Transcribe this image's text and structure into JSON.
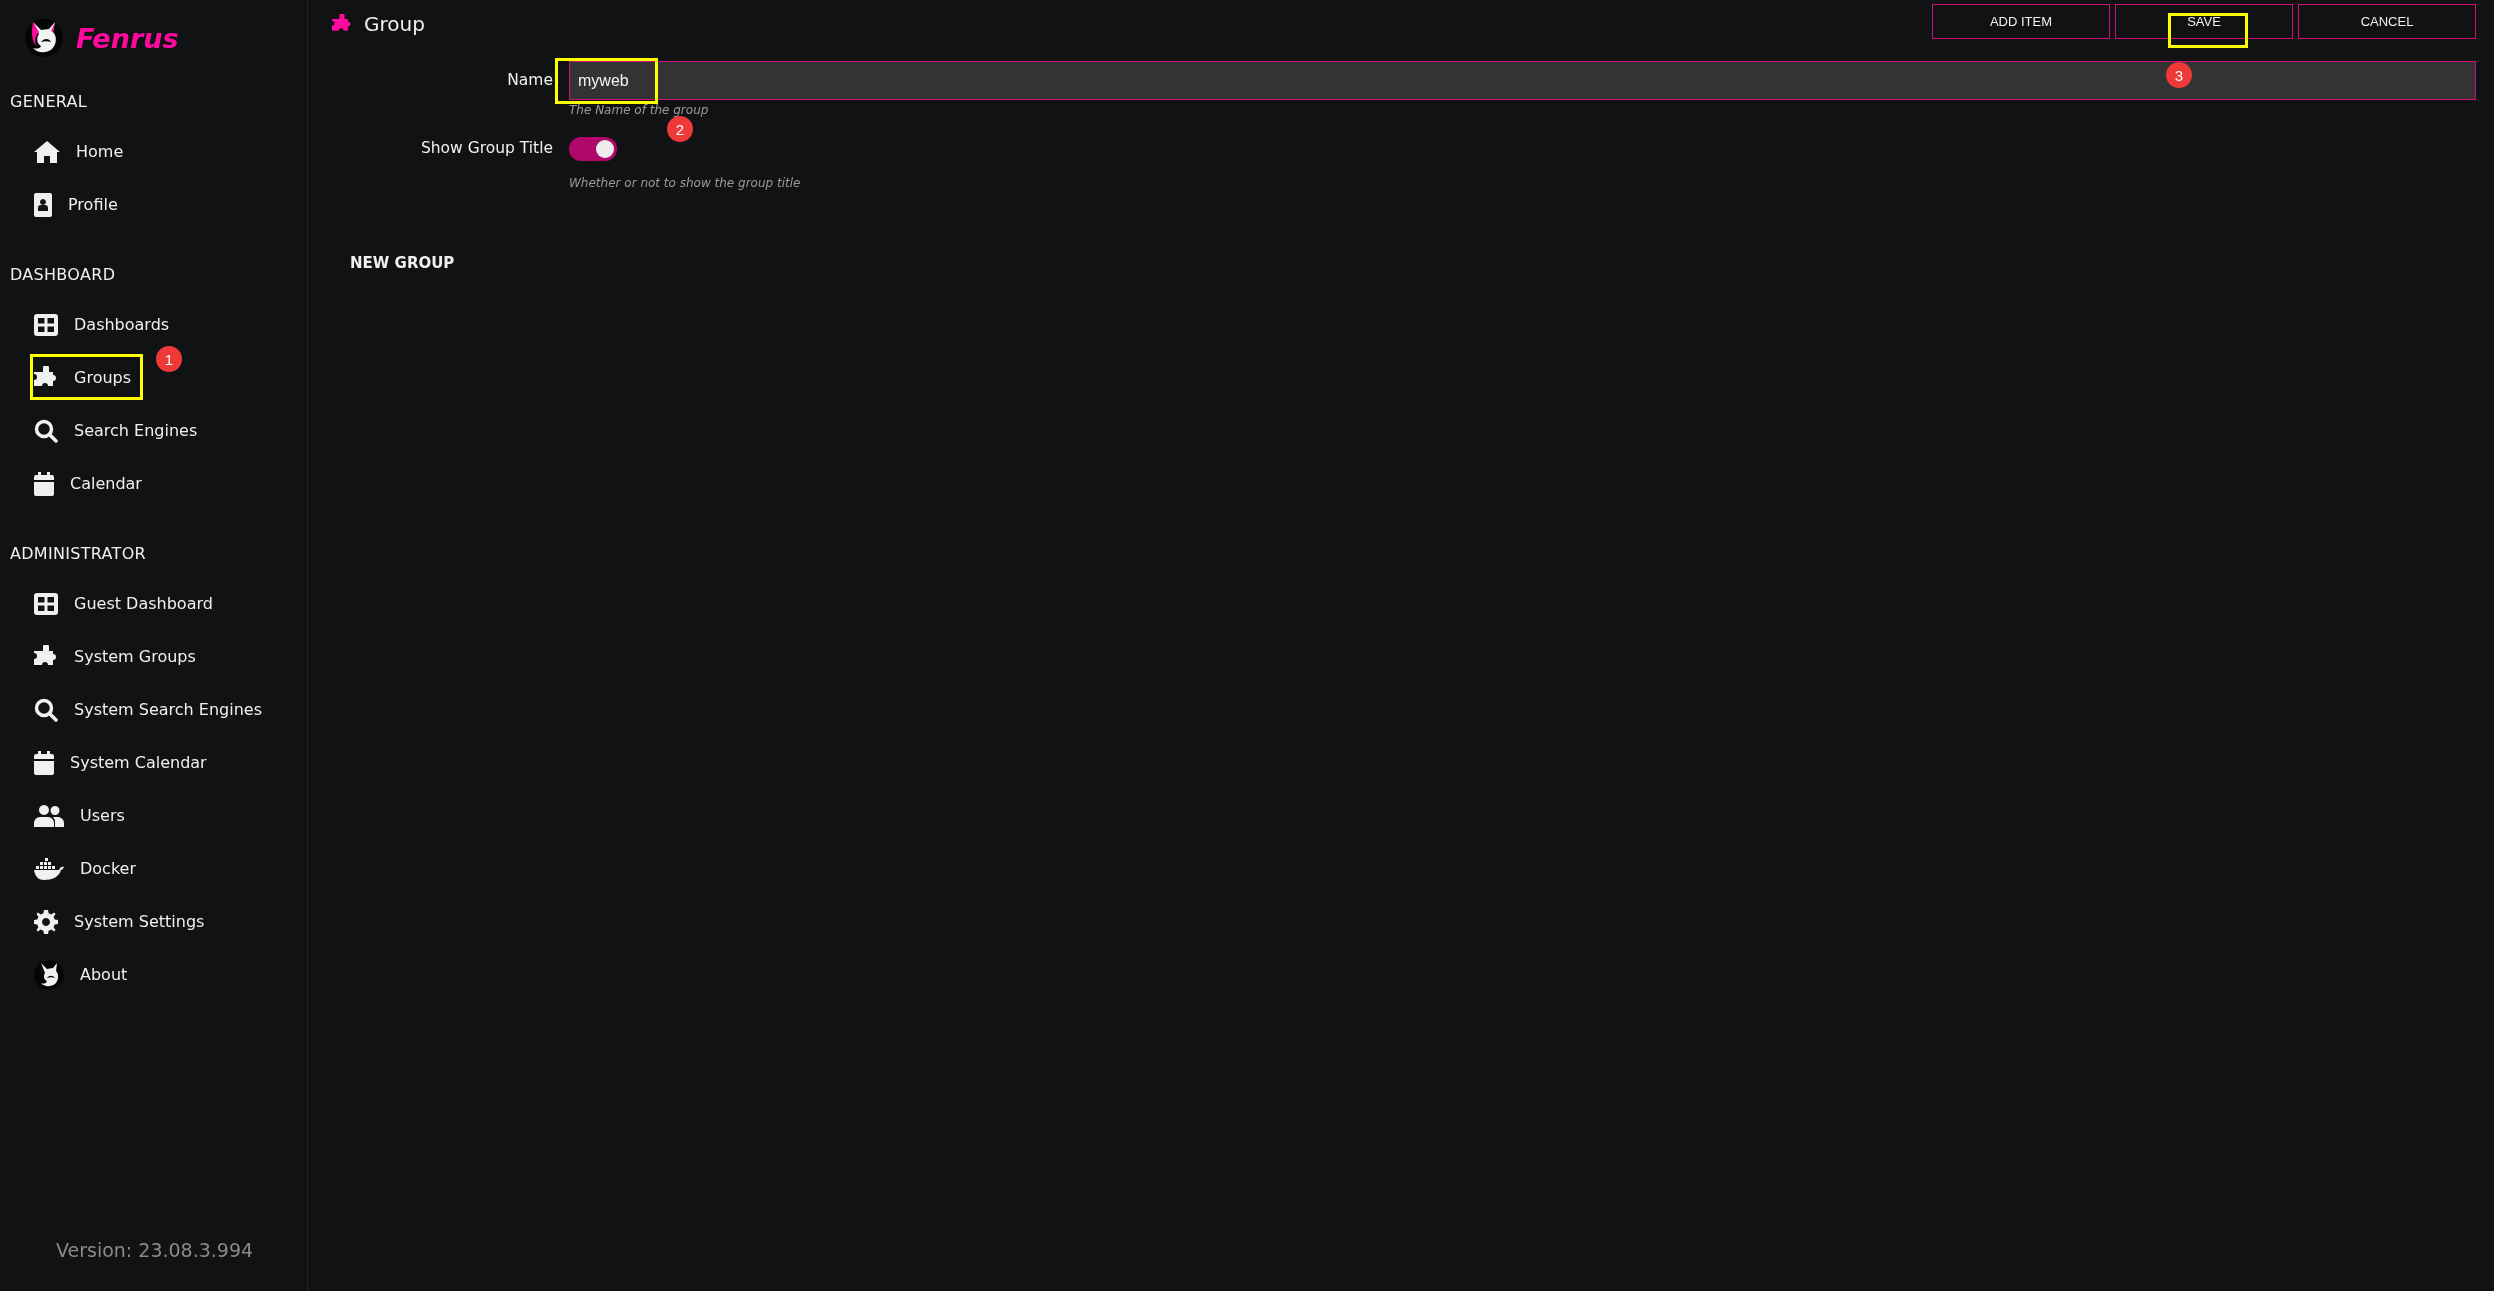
{
  "sidebar": {
    "brand": "Fenrus",
    "sections": [
      {
        "title": "GENERAL",
        "items": [
          {
            "label": "Home",
            "kind": "home",
            "selected": false
          },
          {
            "label": "Profile",
            "kind": "profile",
            "selected": false
          }
        ]
      },
      {
        "title": "DASHBOARD",
        "items": [
          {
            "label": "Dashboards",
            "kind": "grid",
            "selected": false
          },
          {
            "label": "Groups",
            "kind": "puzzle",
            "selected": false,
            "callout": "1"
          },
          {
            "label": "Search Engines",
            "kind": "search",
            "selected": false
          },
          {
            "label": "Calendar",
            "kind": "calendar",
            "selected": false
          }
        ]
      },
      {
        "title": "ADMINISTRATOR",
        "items": [
          {
            "label": "Guest Dashboard",
            "kind": "grid",
            "selected": false
          },
          {
            "label": "System Groups",
            "kind": "puzzle",
            "selected": false
          },
          {
            "label": "System Search Engines",
            "kind": "search",
            "selected": false
          },
          {
            "label": "System Calendar",
            "kind": "calendar",
            "selected": false
          },
          {
            "label": "Users",
            "kind": "users",
            "selected": false
          },
          {
            "label": "Docker",
            "kind": "docker",
            "selected": false
          },
          {
            "label": "System Settings",
            "kind": "gear",
            "selected": false
          },
          {
            "label": "About",
            "kind": "fox",
            "selected": false
          }
        ]
      }
    ],
    "version": "Version: 23.08.3.994"
  },
  "page": {
    "title": "Group",
    "buttons": [
      {
        "label": "ADD ITEM"
      },
      {
        "label": "SAVE",
        "callout": "3"
      },
      {
        "label": "CANCEL"
      }
    ],
    "fields": [
      {
        "kind": "text",
        "label": "Name",
        "value": "myweb",
        "help": "The Name of the group",
        "callout": "2"
      },
      {
        "kind": "toggle",
        "label": "Show Group Title",
        "on": true,
        "help": "Whether or not to show the group title"
      }
    ],
    "preview_title": "NEW GROUP"
  }
}
